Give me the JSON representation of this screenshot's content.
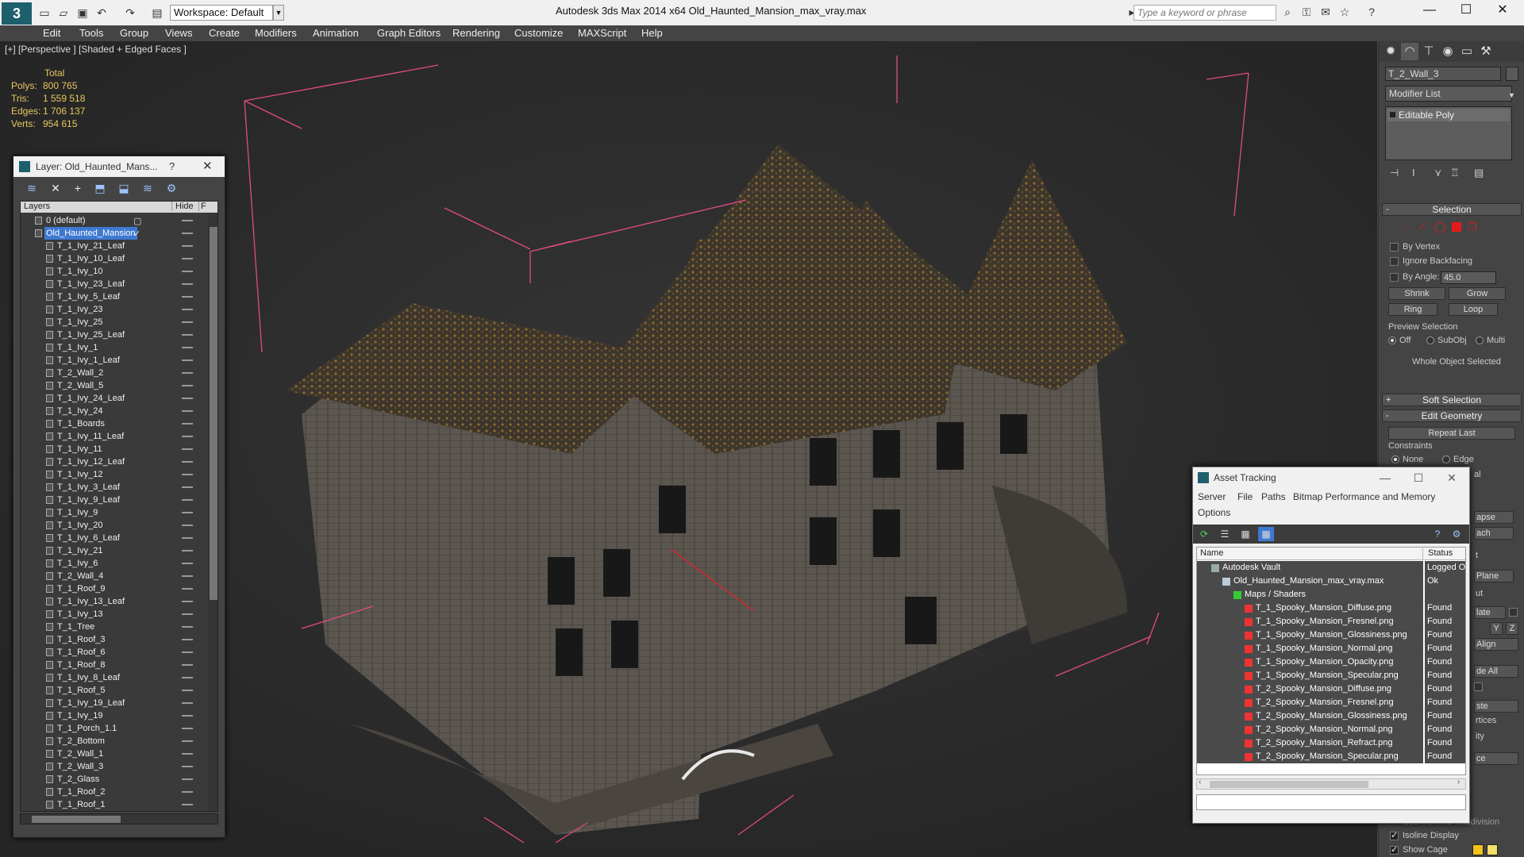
{
  "window": {
    "app_title": "Autodesk 3ds Max  2014 x64     Old_Haunted_Mansion_max_vray.max",
    "workspace": "Workspace: Default",
    "search_placeholder": "Type a keyword or phrase"
  },
  "menu": [
    "Edit",
    "Tools",
    "Group",
    "Views",
    "Create",
    "Modifiers",
    "Animation",
    "Graph Editors",
    "Rendering",
    "Customize",
    "MAXScript",
    "Help"
  ],
  "viewport": {
    "label": "[+] [Perspective ] [Shaded + Edged Faces ]",
    "stats_header": "Total",
    "stats": [
      {
        "k": "Polys:",
        "v": "800 765"
      },
      {
        "k": "Tris:",
        "v": "1 559 518"
      },
      {
        "k": "Edges:",
        "v": "1 706 137"
      },
      {
        "k": "Verts:",
        "v": "954 615"
      }
    ]
  },
  "layer_window": {
    "title": "Layer: Old_Haunted_Mans...",
    "help": "?",
    "col_layers": "Layers",
    "col_hide": "Hide",
    "col_f": "F",
    "rows": [
      {
        "name": "0 (default)",
        "type": "layer"
      },
      {
        "name": "Old_Haunted_Mansion",
        "type": "layer",
        "selected": true
      },
      {
        "name": "T_1_Ivy_21_Leaf"
      },
      {
        "name": "T_1_Ivy_10_Leaf"
      },
      {
        "name": "T_1_Ivy_10"
      },
      {
        "name": "T_1_Ivy_23_Leaf"
      },
      {
        "name": "T_1_Ivy_5_Leaf"
      },
      {
        "name": "T_1_Ivy_23"
      },
      {
        "name": "T_1_Ivy_25"
      },
      {
        "name": "T_1_Ivy_25_Leaf"
      },
      {
        "name": "T_1_Ivy_1"
      },
      {
        "name": "T_1_Ivy_1_Leaf"
      },
      {
        "name": "T_2_Wall_2"
      },
      {
        "name": "T_2_Wall_5"
      },
      {
        "name": "T_1_Ivy_24_Leaf"
      },
      {
        "name": "T_1_Ivy_24"
      },
      {
        "name": "T_1_Boards"
      },
      {
        "name": "T_1_Ivy_11_Leaf"
      },
      {
        "name": "T_1_Ivy_11"
      },
      {
        "name": "T_1_Ivy_12_Leaf"
      },
      {
        "name": "T_1_Ivy_12"
      },
      {
        "name": "T_1_Ivy_3_Leaf"
      },
      {
        "name": "T_1_Ivy_9_Leaf"
      },
      {
        "name": "T_1_Ivy_9"
      },
      {
        "name": "T_1_Ivy_20"
      },
      {
        "name": "T_1_Ivy_6_Leaf"
      },
      {
        "name": "T_1_Ivy_21"
      },
      {
        "name": "T_1_Ivy_6"
      },
      {
        "name": "T_2_Wall_4"
      },
      {
        "name": "T_1_Roof_9"
      },
      {
        "name": "T_1_Ivy_13_Leaf"
      },
      {
        "name": "T_1_Ivy_13"
      },
      {
        "name": "T_1_Tree"
      },
      {
        "name": "T_1_Roof_3"
      },
      {
        "name": "T_1_Roof_6"
      },
      {
        "name": "T_1_Roof_8"
      },
      {
        "name": "T_1_Ivy_8_Leaf"
      },
      {
        "name": "T_1_Roof_5"
      },
      {
        "name": "T_1_Ivy_19_Leaf"
      },
      {
        "name": "T_1_Ivy_19"
      },
      {
        "name": "T_1_Porch_1.1"
      },
      {
        "name": "T_2_Bottom"
      },
      {
        "name": "T_2_Wall_1"
      },
      {
        "name": "T_2_Wall_3"
      },
      {
        "name": "T_2_Glass"
      },
      {
        "name": "T_1_Roof_2"
      },
      {
        "name": "T_1_Roof_1"
      }
    ]
  },
  "command_panel": {
    "object_name": "T_2_Wall_3",
    "modifier_list": "Modifier List",
    "stack_item": "Editable Poly",
    "selection": "Selection",
    "by_vertex": "By Vertex",
    "ignore_backfacing": "Ignore Backfacing",
    "by_angle": "By Angle:",
    "angle_value": "45.0",
    "shrink": "Shrink",
    "grow": "Grow",
    "ring": "Ring",
    "loop": "Loop",
    "preview_selection": "Preview Selection",
    "off": "Off",
    "subobj": "SubObj",
    "multi": "Multi",
    "whole_object": "Whole Object Selected",
    "soft_selection": "Soft Selection",
    "edit_geometry": "Edit Geometry",
    "repeat_last": "Repeat Last",
    "constraints": "Constraints",
    "none": "None",
    "edge": "Edge",
    "isoline": "Isoline Display",
    "show_cage": "Show Cage",
    "use_nurms": "Use NURMS Subdivision",
    "cut_al": "al",
    "cut_apse": "apse",
    "cut_ach": "ach",
    "cut_t": "t",
    "cut_plane": "Plane",
    "cut_ut": "ut",
    "cut_late": "late",
    "cut_xy": "Y",
    "cut_z": "Z",
    "cut_align": "Align",
    "cut_deall": "de All",
    "cut_ste": "ste",
    "cut_rtices": "rtices",
    "cut_ity": "ity",
    "cut_ce": "ce",
    "accent_red": "#e31b1b",
    "swatch_yellow": "#f3c21a"
  },
  "asset_tracking": {
    "title": "Asset Tracking",
    "menu": [
      "Server",
      "File",
      "Paths",
      "Bitmap Performance and Memory",
      "Options"
    ],
    "col_name": "Name",
    "col_status": "Status",
    "rows": [
      {
        "name": "Autodesk Vault",
        "status": "Logged Ou",
        "level": 1,
        "icon": "vault"
      },
      {
        "name": "Old_Haunted_Mansion_max_vray.max",
        "status": "Ok",
        "level": 2,
        "icon": "file"
      },
      {
        "name": "Maps / Shaders",
        "status": "",
        "level": 3,
        "icon": "folder"
      },
      {
        "name": "T_1_Spooky_Mansion_Diffuse.png",
        "status": "Found",
        "level": 4,
        "icon": "png"
      },
      {
        "name": "T_1_Spooky_Mansion_Fresnel.png",
        "status": "Found",
        "level": 4,
        "icon": "png"
      },
      {
        "name": "T_1_Spooky_Mansion_Glossiness.png",
        "status": "Found",
        "level": 4,
        "icon": "png"
      },
      {
        "name": "T_1_Spooky_Mansion_Normal.png",
        "status": "Found",
        "level": 4,
        "icon": "png"
      },
      {
        "name": "T_1_Spooky_Mansion_Opacity.png",
        "status": "Found",
        "level": 4,
        "icon": "png"
      },
      {
        "name": "T_1_Spooky_Mansion_Specular.png",
        "status": "Found",
        "level": 4,
        "icon": "png"
      },
      {
        "name": "T_2_Spooky_Mansion_Diffuse.png",
        "status": "Found",
        "level": 4,
        "icon": "png"
      },
      {
        "name": "T_2_Spooky_Mansion_Fresnel.png",
        "status": "Found",
        "level": 4,
        "icon": "png"
      },
      {
        "name": "T_2_Spooky_Mansion_Glossiness.png",
        "status": "Found",
        "level": 4,
        "icon": "png"
      },
      {
        "name": "T_2_Spooky_Mansion_Normal.png",
        "status": "Found",
        "level": 4,
        "icon": "png"
      },
      {
        "name": "T_2_Spooky_Mansion_Refract.png",
        "status": "Found",
        "level": 4,
        "icon": "png"
      },
      {
        "name": "T_2_Spooky_Mansion_Specular.png",
        "status": "Found",
        "level": 4,
        "icon": "png"
      }
    ]
  }
}
